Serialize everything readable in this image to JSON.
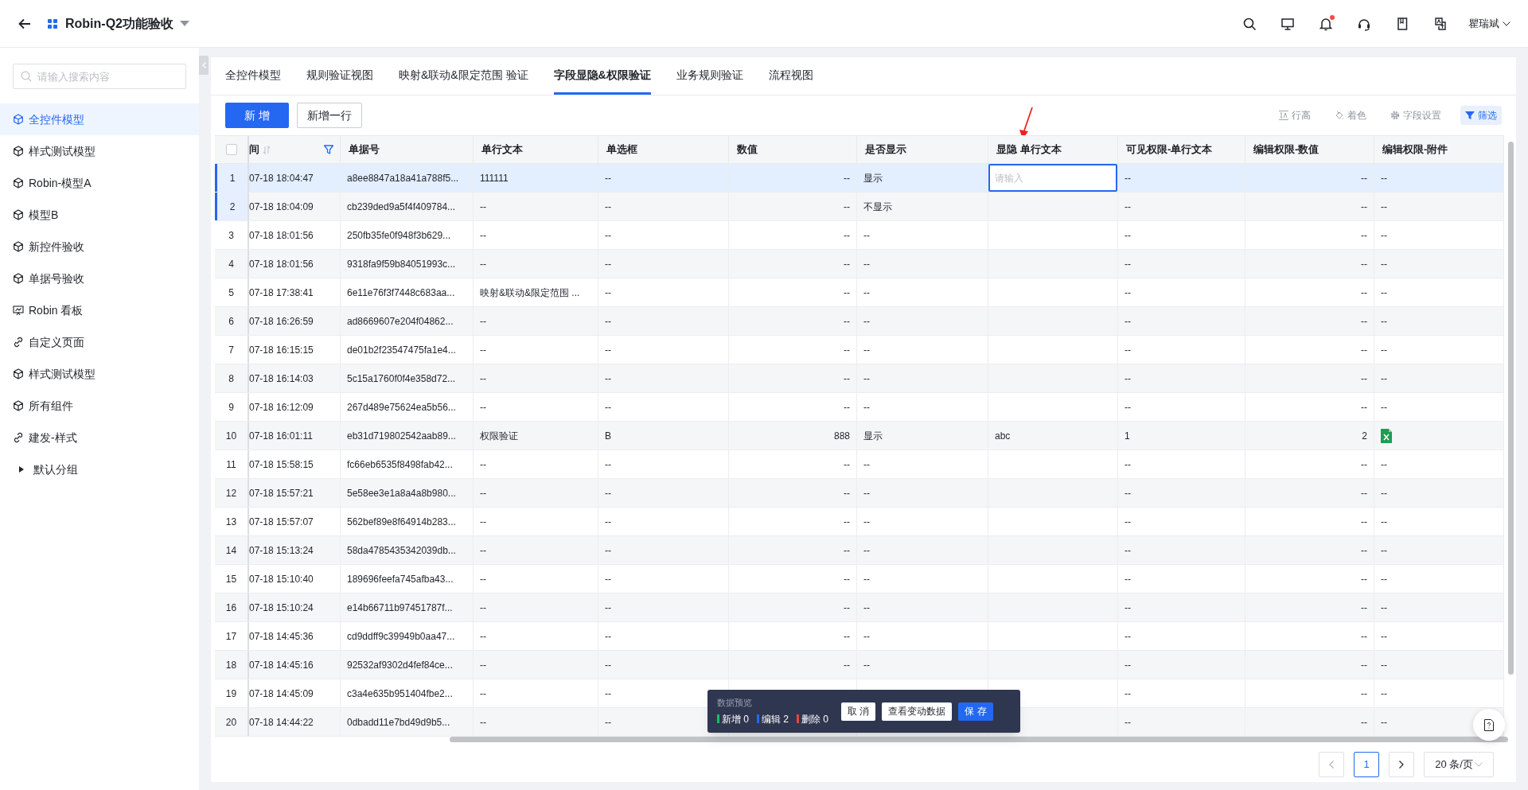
{
  "top_bar": {
    "title": "Robin-Q2功能验收",
    "user": "瞿瑞斌",
    "notification_dot": true
  },
  "sidebar": {
    "search": {
      "placeholder": "请输入搜索内容"
    },
    "items": [
      {
        "label": "全控件模型",
        "kind": "model",
        "selected": true
      },
      {
        "label": "样式测试模型",
        "kind": "model",
        "selected": false
      },
      {
        "label": "Robin-模型A",
        "kind": "model",
        "selected": false
      },
      {
        "label": "模型B",
        "kind": "model",
        "selected": false
      },
      {
        "label": "新控件验收",
        "kind": "model",
        "selected": false
      },
      {
        "label": "单据号验收",
        "kind": "model",
        "selected": false
      },
      {
        "label": "Robin 看板",
        "kind": "dashboard",
        "selected": false
      },
      {
        "label": "自定义页面",
        "kind": "link",
        "selected": false
      },
      {
        "label": "样式测试模型",
        "kind": "model",
        "selected": false
      },
      {
        "label": "所有组件",
        "kind": "model",
        "selected": false
      },
      {
        "label": "建发-样式",
        "kind": "link",
        "selected": false
      },
      {
        "label": "默认分组",
        "kind": "group",
        "selected": false
      }
    ]
  },
  "tabs": [
    {
      "label": "全控件模型",
      "selected": false
    },
    {
      "label": "规则验证视图",
      "selected": false
    },
    {
      "label": "映射&联动&限定范围 验证",
      "selected": false
    },
    {
      "label": "字段显隐&权限验证",
      "selected": true
    },
    {
      "label": "业务规则验证",
      "selected": false
    },
    {
      "label": "流程视图",
      "selected": false
    }
  ],
  "toolbar": {
    "buttons": [
      {
        "label": "新 增",
        "kind": "primary"
      },
      {
        "label": "新增一行",
        "kind": "default"
      }
    ],
    "tools": [
      {
        "label": "行高",
        "kind": "row-height",
        "active": false
      },
      {
        "label": "着色",
        "kind": "color",
        "active": false
      },
      {
        "label": "字段设置",
        "kind": "settings",
        "active": false
      },
      {
        "label": "筛选",
        "kind": "filter",
        "active": true
      }
    ]
  },
  "table": {
    "select_all": {
      "checked": false
    },
    "columns": [
      {
        "label": "间",
        "kind": "time",
        "filtered": true
      },
      {
        "label": "单据号",
        "kind": "text",
        "filtered": false
      },
      {
        "label": "单行文本",
        "kind": "text",
        "filtered": false
      },
      {
        "label": "单选框",
        "kind": "text",
        "filtered": false
      },
      {
        "label": "数值",
        "kind": "number",
        "filtered": false
      },
      {
        "label": "是否显示",
        "kind": "text",
        "filtered": false
      },
      {
        "label": "显隐 单行文本",
        "kind": "text",
        "filtered": false
      },
      {
        "label": "可见权限-单行文本",
        "kind": "text",
        "filtered": false
      },
      {
        "label": "编辑权限-数值",
        "kind": "number",
        "filtered": false
      },
      {
        "label": "编辑权限-附件",
        "kind": "text",
        "filtered": false
      }
    ],
    "rows": [
      {
        "index": "1",
        "selected": true,
        "edited": true,
        "cells": [
          "07-18 18:04:47",
          "a8ee8847a18a41a788f5...",
          "111111",
          "--",
          "--",
          "显示",
          {
            "kind": "input",
            "placeholder": "请输入"
          },
          "--",
          "--",
          "--"
        ]
      },
      {
        "index": "2",
        "selected": false,
        "edited": true,
        "cells": [
          "07-18 18:04:09",
          "cb239ded9a5f4f409784...",
          "--",
          "--",
          "--",
          "不显示",
          null,
          "--",
          "--",
          "--"
        ]
      },
      {
        "index": "3",
        "selected": false,
        "edited": false,
        "cells": [
          "07-18 18:01:56",
          "250fb35fe0f948f3b629...",
          "--",
          "--",
          "--",
          "--",
          null,
          "--",
          "--",
          "--"
        ]
      },
      {
        "index": "4",
        "selected": false,
        "edited": false,
        "cells": [
          "07-18 18:01:56",
          "9318fa9f59b84051993c...",
          "--",
          "--",
          "--",
          "--",
          null,
          "--",
          "--",
          "--"
        ]
      },
      {
        "index": "5",
        "selected": false,
        "edited": false,
        "cells": [
          "07-18 17:38:41",
          "6e11e76f3f7448c683aa...",
          "映射&联动&限定范围 ...",
          "--",
          "--",
          "--",
          null,
          "--",
          "--",
          "--"
        ]
      },
      {
        "index": "6",
        "selected": false,
        "edited": false,
        "cells": [
          "07-18 16:26:59",
          "ad8669607e204f04862...",
          "--",
          "--",
          "--",
          "--",
          null,
          "--",
          "--",
          "--"
        ]
      },
      {
        "index": "7",
        "selected": false,
        "edited": false,
        "cells": [
          "07-18 16:15:15",
          "de01b2f23547475fa1e4...",
          "--",
          "--",
          "--",
          "--",
          null,
          "--",
          "--",
          "--"
        ]
      },
      {
        "index": "8",
        "selected": false,
        "edited": false,
        "cells": [
          "07-18 16:14:03",
          "5c15a1760f0f4e358d72...",
          "--",
          "--",
          "--",
          "--",
          null,
          "--",
          "--",
          "--"
        ]
      },
      {
        "index": "9",
        "selected": false,
        "edited": false,
        "cells": [
          "07-18 16:12:09",
          "267d489e75624ea5b56...",
          "--",
          "--",
          "--",
          "--",
          null,
          "--",
          "--",
          "--"
        ]
      },
      {
        "index": "10",
        "selected": false,
        "edited": false,
        "cells": [
          "07-18 16:01:11",
          "eb31d719802542aab89...",
          "权限验证",
          "B",
          "888",
          "显示",
          "abc",
          "1",
          "2",
          {
            "kind": "excel-file"
          }
        ]
      },
      {
        "index": "11",
        "selected": false,
        "edited": false,
        "cells": [
          "07-18 15:58:15",
          "fc66eb6535f8498fab42...",
          "--",
          "--",
          "--",
          "--",
          null,
          "--",
          "--",
          "--"
        ]
      },
      {
        "index": "12",
        "selected": false,
        "edited": false,
        "cells": [
          "07-18 15:57:21",
          "5e58ee3e1a8a4a8b980...",
          "--",
          "--",
          "--",
          "--",
          null,
          "--",
          "--",
          "--"
        ]
      },
      {
        "index": "13",
        "selected": false,
        "edited": false,
        "cells": [
          "07-18 15:57:07",
          "562bef89e8f64914b283...",
          "--",
          "--",
          "--",
          "--",
          null,
          "--",
          "--",
          "--"
        ]
      },
      {
        "index": "14",
        "selected": false,
        "edited": false,
        "cells": [
          "07-18 15:13:24",
          "58da4785435342039db...",
          "--",
          "--",
          "--",
          "--",
          null,
          "--",
          "--",
          "--"
        ]
      },
      {
        "index": "15",
        "selected": false,
        "edited": false,
        "cells": [
          "07-18 15:10:40",
          "189696feefa745afba43...",
          "--",
          "--",
          "--",
          "--",
          null,
          "--",
          "--",
          "--"
        ]
      },
      {
        "index": "16",
        "selected": false,
        "edited": false,
        "cells": [
          "07-18 15:10:24",
          "e14b66711b97451787f...",
          "--",
          "--",
          "--",
          "--",
          null,
          "--",
          "--",
          "--"
        ]
      },
      {
        "index": "17",
        "selected": false,
        "edited": false,
        "cells": [
          "07-18 14:45:36",
          "cd9ddff9c39949b0aa47...",
          "--",
          "--",
          "--",
          "--",
          null,
          "--",
          "--",
          "--"
        ]
      },
      {
        "index": "18",
        "selected": false,
        "edited": false,
        "cells": [
          "07-18 14:45:16",
          "92532af9302d4fef84ce...",
          "--",
          "--",
          "--",
          "--",
          null,
          "--",
          "--",
          "--"
        ]
      },
      {
        "index": "19",
        "selected": false,
        "edited": false,
        "cells": [
          "07-18 14:45:09",
          "c3a4e635b951404fbe2...",
          "--",
          "--",
          null,
          null,
          null,
          "--",
          "--",
          "--"
        ]
      },
      {
        "index": "20",
        "selected": false,
        "edited": false,
        "cells": [
          "07-18 14:44:22",
          "0dbadd11e7bd49d9b5...",
          "--",
          "--",
          null,
          null,
          null,
          "--",
          "--",
          "--"
        ]
      }
    ]
  },
  "change_preview": {
    "title": "数据预览",
    "counts": [
      {
        "text": "新增 0",
        "color": "#19be6b"
      },
      {
        "text": "编辑 2",
        "color": "#2468f2"
      },
      {
        "text": "删除 0",
        "color": "#e8453c"
      }
    ],
    "buttons": [
      {
        "label": "取 消",
        "kind": "default"
      },
      {
        "label": "查看变动数据",
        "kind": "default"
      },
      {
        "label": "保 存",
        "kind": "primary"
      }
    ]
  },
  "pagination": {
    "pages": [
      {
        "label": "1",
        "selected": true
      }
    ],
    "page_size": "20 条/页"
  }
}
